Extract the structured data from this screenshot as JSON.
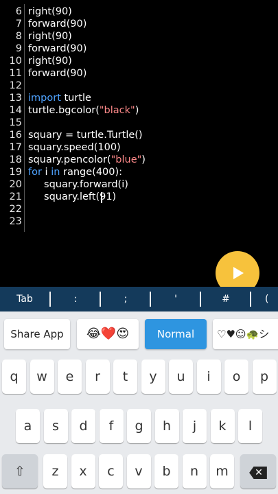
{
  "editor": {
    "lines": [
      {
        "num": "6",
        "parts": [
          {
            "t": "right(90)",
            "c": "plain"
          }
        ]
      },
      {
        "num": "7",
        "parts": [
          {
            "t": "forward(90)",
            "c": "plain"
          }
        ]
      },
      {
        "num": "8",
        "parts": [
          {
            "t": "right(90)",
            "c": "plain"
          }
        ]
      },
      {
        "num": "9",
        "parts": [
          {
            "t": "forward(90)",
            "c": "plain"
          }
        ]
      },
      {
        "num": "10",
        "parts": [
          {
            "t": "right(90)",
            "c": "plain"
          }
        ]
      },
      {
        "num": "11",
        "parts": [
          {
            "t": "forward(90)",
            "c": "plain"
          }
        ]
      },
      {
        "num": "12",
        "parts": []
      },
      {
        "num": "13",
        "parts": [
          {
            "t": "import",
            "c": "kw"
          },
          {
            "t": " turtle",
            "c": "plain"
          }
        ]
      },
      {
        "num": "14",
        "parts": [
          {
            "t": "turtle.bgcolor(",
            "c": "plain"
          },
          {
            "t": "\"black\"",
            "c": "str"
          },
          {
            "t": ")",
            "c": "plain"
          }
        ]
      },
      {
        "num": "15",
        "parts": []
      },
      {
        "num": "16",
        "parts": [
          {
            "t": "squary = turtle.Turtle()",
            "c": "plain"
          }
        ]
      },
      {
        "num": "17",
        "parts": [
          {
            "t": "squary.speed(100)",
            "c": "plain"
          }
        ]
      },
      {
        "num": "18",
        "parts": [
          {
            "t": "squary.pencolor(",
            "c": "plain"
          },
          {
            "t": "\"blue\"",
            "c": "str"
          },
          {
            "t": ")",
            "c": "plain"
          }
        ]
      },
      {
        "num": "19",
        "parts": [
          {
            "t": "for",
            "c": "kw"
          },
          {
            "t": " i ",
            "c": "plain"
          },
          {
            "t": "in",
            "c": "kw"
          },
          {
            "t": " range(400):",
            "c": "plain"
          }
        ]
      },
      {
        "num": "20",
        "parts": [
          {
            "t": "     squary.forward(i)",
            "c": "plain"
          }
        ]
      },
      {
        "num": "21",
        "parts": [
          {
            "t": "     squary.left(91)",
            "c": "plain"
          }
        ]
      },
      {
        "num": "22",
        "parts": []
      },
      {
        "num": "23",
        "parts": []
      }
    ]
  },
  "symbols": [
    "Tab",
    ":",
    ";",
    "'",
    "#",
    "("
  ],
  "suggestions": {
    "share": "Share App",
    "emoji": "😂❤️😍",
    "normal": "Normal",
    "symbols": "♡♥☺🐢シ"
  },
  "keyboard": {
    "row1": [
      "q",
      "w",
      "e",
      "r",
      "t",
      "y",
      "u",
      "i",
      "o",
      "p"
    ],
    "row2": [
      "a",
      "s",
      "d",
      "f",
      "g",
      "h",
      "j",
      "k",
      "l"
    ],
    "row3": [
      "z",
      "x",
      "c",
      "v",
      "b",
      "n",
      "m"
    ],
    "shift_glyph": "⇧",
    "backspace_glyph": "✕"
  },
  "colors": {
    "accent": "#f7c23c",
    "symbar": "#143a5b",
    "keyword": "#4fa3ff",
    "string": "#ff8a8a"
  }
}
